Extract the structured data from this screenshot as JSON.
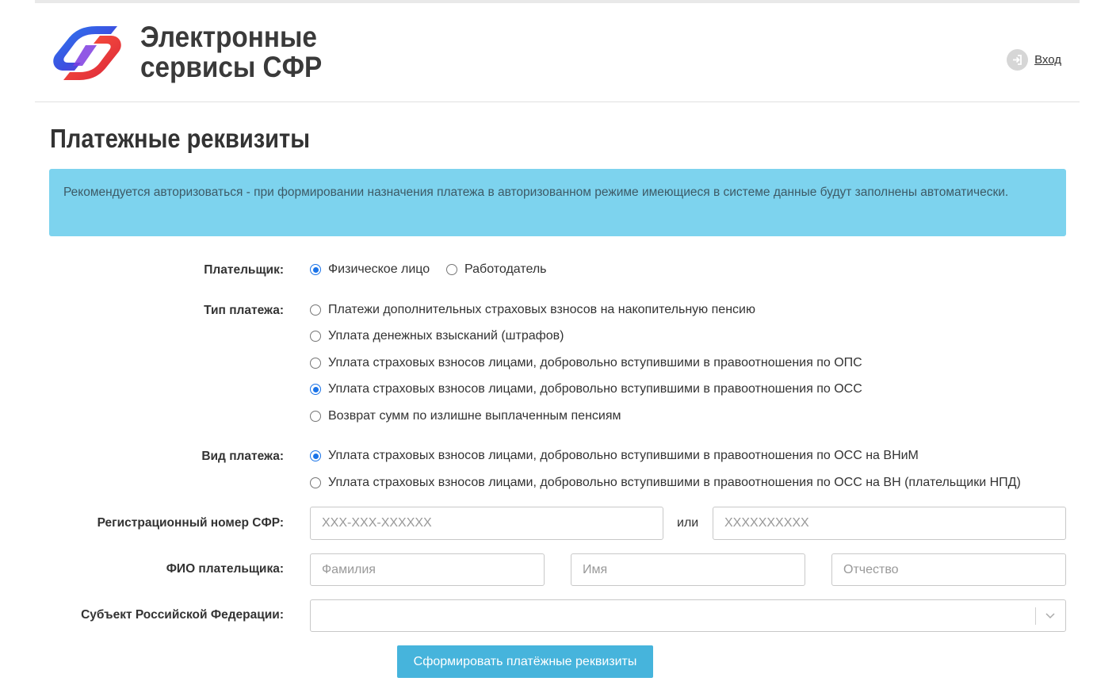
{
  "header": {
    "logo_line1": "Электронные",
    "logo_line2": "сервисы СФР",
    "logout_label": "Вход",
    "brand_colors": {
      "blue": "#1e5bd6",
      "red": "#e63a3a",
      "purple": "#7b2fd8"
    }
  },
  "page": {
    "title": "Платежные реквизиты"
  },
  "alert": {
    "text": "Рекомендуется авторизоваться - при формировании назначения платежа в авторизованном режиме имеющиеся в системе данные будут заполнены автоматически.",
    "color": "#7dd3ee"
  },
  "form": {
    "payer": {
      "label": "Плательщик:",
      "options": [
        {
          "label": "Физическое лицо",
          "selected": true
        },
        {
          "label": "Работодатель",
          "selected": false
        }
      ]
    },
    "payment_type": {
      "label": "Тип платежа:",
      "options": [
        {
          "label": "Платежи дополнительных страховых взносов на накопительную пенсию",
          "selected": false
        },
        {
          "label": "Уплата денежных взысканий (штрафов)",
          "selected": false
        },
        {
          "label": "Уплата страховых взносов лицами, добровольно вступившими в правоотношения по ОПС",
          "selected": false
        },
        {
          "label": "Уплата страховых взносов лицами, добровольно вступившими в правоотношения по ОСС",
          "selected": true
        },
        {
          "label": "Возврат сумм по излишне выплаченным пенсиям",
          "selected": false
        }
      ]
    },
    "payment_kind": {
      "label": "Вид платежа:",
      "options": [
        {
          "label": "Уплата страховых взносов лицами, добровольно вступившими в правоотношения по ОСС на ВНиМ",
          "selected": true
        },
        {
          "label": "Уплата страховых взносов лицами, добровольно вступившими в правоотношения по ОСС на ВН (плательщики НПД)",
          "selected": false
        }
      ]
    },
    "reg_number": {
      "label": "Регистрационный номер СФР:",
      "placeholder1": "XXX-XXX-XXXXXX",
      "or_label": "или",
      "placeholder2": "XXXXXXXXXX",
      "value1": "",
      "value2": ""
    },
    "fio": {
      "label": "ФИО плательщика:",
      "surname_placeholder": "Фамилия",
      "name_placeholder": "Имя",
      "patronymic_placeholder": "Отчество"
    },
    "region": {
      "label": "Субъект Российской Федерации:",
      "selected_value": ""
    },
    "submit_label": "Сформировать платёжные реквизиты",
    "accent_color": "#46b4dc"
  }
}
